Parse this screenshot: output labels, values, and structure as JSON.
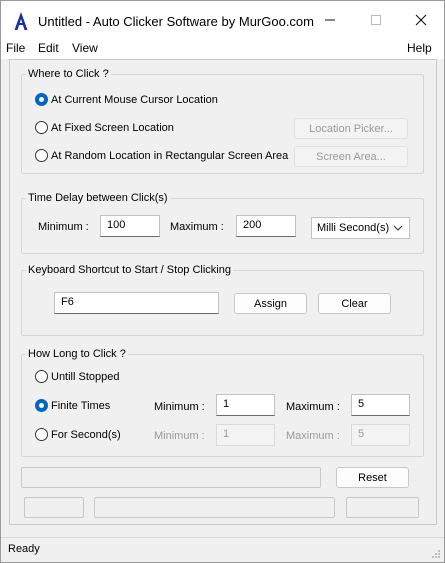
{
  "window": {
    "title": "Untitled - Auto Clicker Software by MurGoo.com",
    "app_icon": "app-a-icon"
  },
  "menu": {
    "file": "File",
    "edit": "Edit",
    "view": "View",
    "help": "Help"
  },
  "where": {
    "label": "Where to Click ?",
    "options": [
      {
        "label": "At Current Mouse Cursor Location",
        "checked": true
      },
      {
        "label": "At Fixed Screen Location",
        "checked": false
      },
      {
        "label": "At Random Location in Rectangular Screen Area",
        "checked": false
      }
    ],
    "location_picker": "Location Picker...",
    "screen_area": "Screen Area..."
  },
  "delay": {
    "label": "Time Delay between Click(s)",
    "min_label": "Minimum :",
    "min_value": "100",
    "max_label": "Maximum :",
    "max_value": "200",
    "unit": "Milli Second(s)"
  },
  "shortcut": {
    "label": "Keyboard Shortcut to Start / Stop Clicking",
    "value": "F6",
    "assign": "Assign",
    "clear": "Clear"
  },
  "how_long": {
    "label": "How Long to Click ?",
    "until_stopped": "Untill Stopped",
    "finite_times": "Finite Times",
    "for_seconds": "For Second(s)",
    "finite": {
      "min_label": "Minimum :",
      "min_value": "1",
      "max_label": "Maximum :",
      "max_value": "5"
    },
    "seconds": {
      "min_label": "Minimum :",
      "min_value": "1",
      "max_label": "Maximum :",
      "max_value": "5"
    }
  },
  "reset": "Reset",
  "status": "Ready",
  "colors": {
    "accent": "#0067c0",
    "icon_blue": "#1a2fa0"
  }
}
